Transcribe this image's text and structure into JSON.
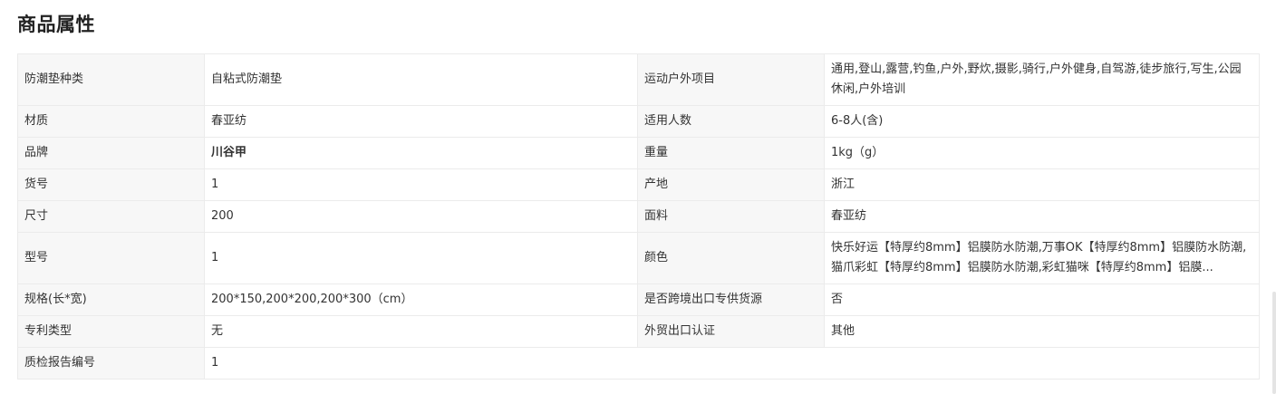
{
  "section": {
    "title": "商品属性"
  },
  "rows": [
    {
      "k1": "防潮垫种类",
      "v1": "自粘式防潮垫",
      "k2": "运动户外项目",
      "v2": "通用,登山,露营,钓鱼,户外,野炊,摄影,骑行,户外健身,自驾游,徒步旅行,写生,公园休闲,户外培训"
    },
    {
      "k1": "材质",
      "v1": "春亚纺",
      "k2": "适用人数",
      "v2": "6-8人(含)"
    },
    {
      "k1": "品牌",
      "v1": "川谷甲",
      "k2": "重量",
      "v2": "1kg（g）"
    },
    {
      "k1": "货号",
      "v1": "1",
      "k2": "产地",
      "v2": "浙江"
    },
    {
      "k1": "尺寸",
      "v1": "200",
      "k2": "面料",
      "v2": "春亚纺"
    },
    {
      "k1": "型号",
      "v1": "1",
      "k2": "颜色",
      "v2": "快乐好运【特厚约8mm】铝膜防水防潮,万事OK【特厚约8mm】铝膜防水防潮,猫爪彩虹【特厚约8mm】铝膜防水防潮,彩虹猫咪【特厚约8mm】铝膜..."
    },
    {
      "k1": "规格(长*宽)",
      "v1": "200*150,200*200,200*300（cm）",
      "k2": "是否跨境出口专供货源",
      "v2": "否"
    },
    {
      "k1": "专利类型",
      "v1": "无",
      "k2": "外贸出口认证",
      "v2": "其他"
    },
    {
      "k1": "质检报告编号",
      "v1": "1"
    }
  ]
}
